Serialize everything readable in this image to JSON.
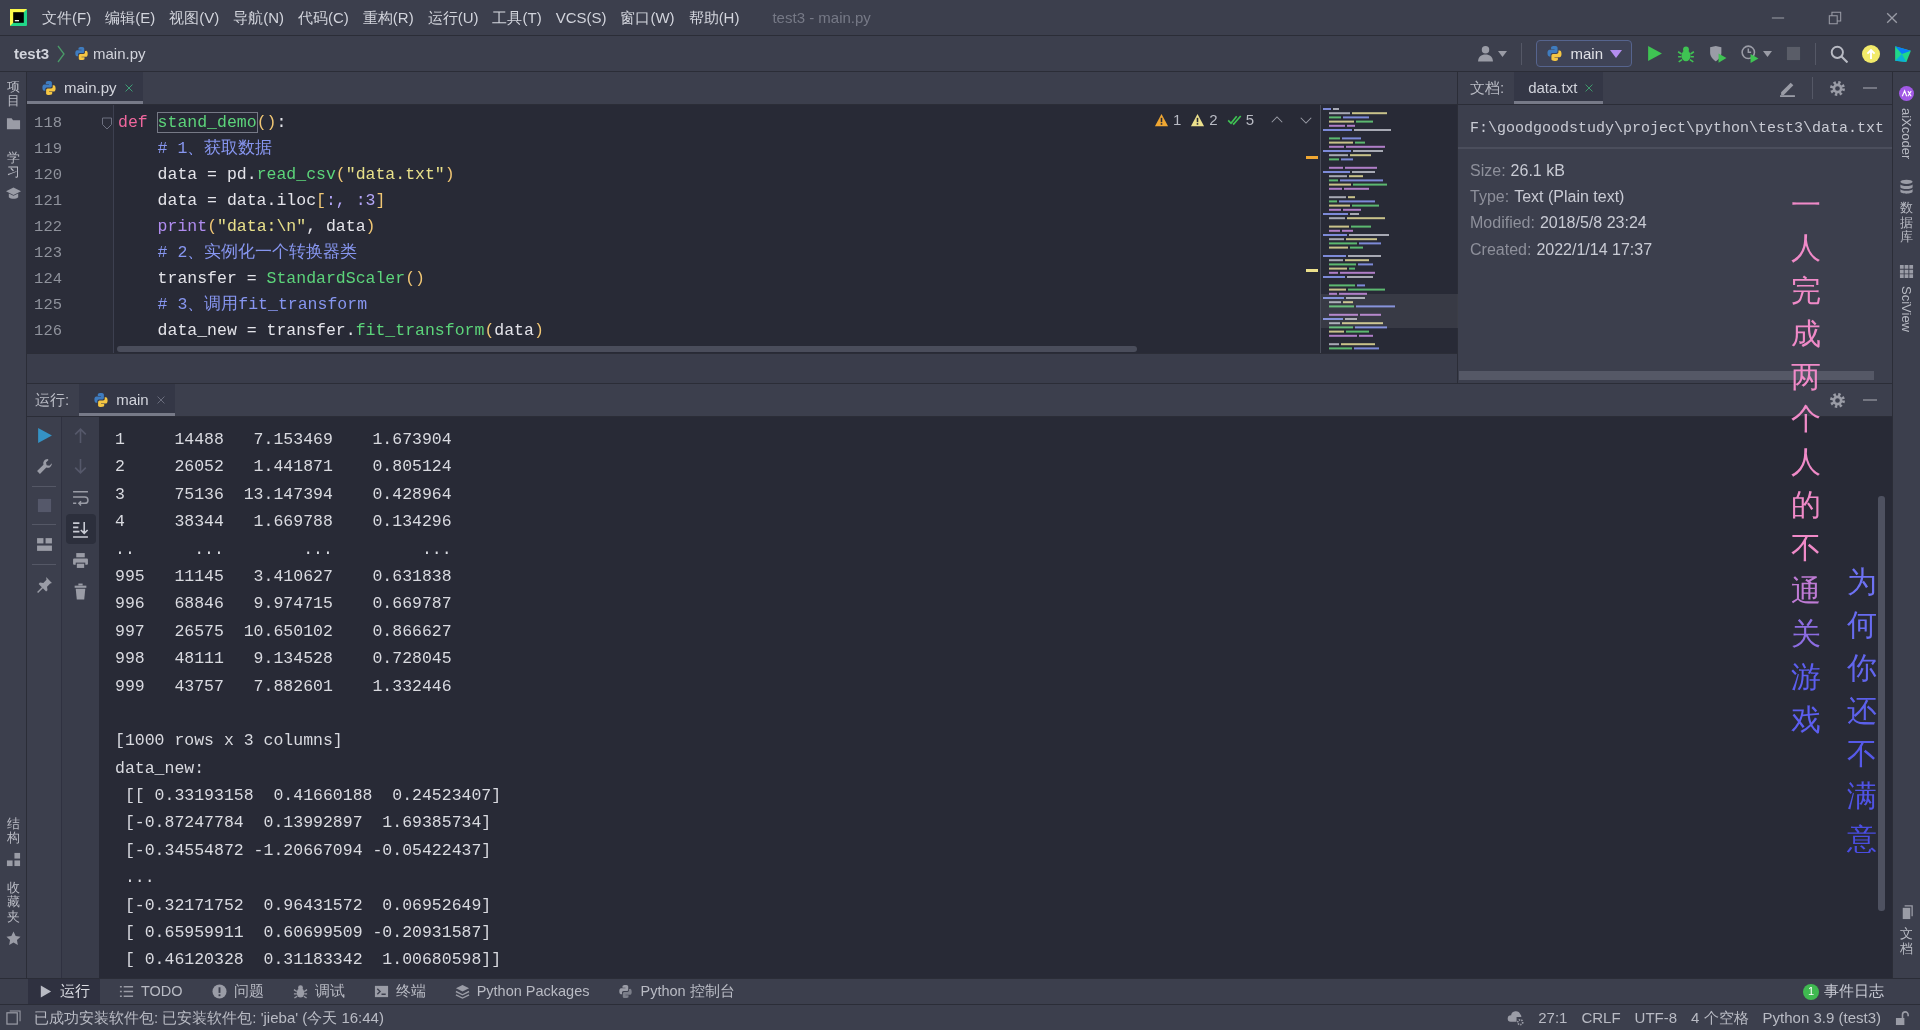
{
  "window": {
    "title": "test3 - main.py"
  },
  "menu": [
    "文件(F)",
    "编辑(E)",
    "视图(V)",
    "导航(N)",
    "代码(C)",
    "重构(R)",
    "运行(U)",
    "工具(T)",
    "VCS(S)",
    "窗口(W)",
    "帮助(H)"
  ],
  "breadcrumb": [
    {
      "label": "test3",
      "kind": "project"
    },
    {
      "label": "main.py",
      "kind": "file"
    }
  ],
  "main_toolbar": {
    "run_config": "main",
    "stop": {
      "disabled": true
    }
  },
  "left_strip": {
    "top": [
      {
        "label": "项目",
        "kind": "stacked"
      },
      {
        "label": "学习",
        "kind": "stacked"
      }
    ],
    "bottom": [
      {
        "label": "结构",
        "kind": "stacked"
      },
      {
        "label": "收藏夹",
        "kind": "stacked"
      }
    ]
  },
  "editor": {
    "tabs": [
      {
        "label": "main.py",
        "selected": true
      }
    ],
    "inspections": [
      {
        "kind": "warning",
        "count": "1"
      },
      {
        "kind": "weak_warning",
        "count": "2"
      },
      {
        "kind": "typo",
        "count": "5"
      }
    ],
    "lines": [
      {
        "number": "118",
        "foldable": true,
        "tokens": [
          {
            "kind": "keyword",
            "text": "def ",
            "highlighted": false
          },
          {
            "kind": "function",
            "text": "stand_demo",
            "highlighted": true
          },
          {
            "kind": "paren",
            "text": "()",
            "highlighted": false
          },
          {
            "kind": "plain",
            "text": ":",
            "highlighted": false
          }
        ]
      },
      {
        "number": "119",
        "foldable": false,
        "tokens": [
          {
            "kind": "comment",
            "text": "    # 1、获取数据",
            "highlighted": false
          }
        ]
      },
      {
        "number": "120",
        "foldable": false,
        "tokens": [
          {
            "kind": "plain",
            "text": "    data = pd.",
            "highlighted": false
          },
          {
            "kind": "function",
            "text": "read_csv",
            "highlighted": false
          },
          {
            "kind": "paren",
            "text": "(",
            "highlighted": false
          },
          {
            "kind": "string",
            "text": "\"data.txt\"",
            "highlighted": false
          },
          {
            "kind": "paren",
            "text": ")",
            "highlighted": false
          }
        ]
      },
      {
        "number": "121",
        "foldable": false,
        "tokens": [
          {
            "kind": "plain",
            "text": "    data = data.iloc",
            "highlighted": false
          },
          {
            "kind": "paren",
            "text": "[",
            "highlighted": false
          },
          {
            "kind": "bracket",
            "text": ":, :3",
            "highlighted": false
          },
          {
            "kind": "paren",
            "text": "]",
            "highlighted": false
          }
        ]
      },
      {
        "number": "122",
        "foldable": false,
        "tokens": [
          {
            "kind": "builtin",
            "text": "    print",
            "highlighted": false
          },
          {
            "kind": "paren",
            "text": "(",
            "highlighted": false
          },
          {
            "kind": "string",
            "text": "\"data:\\n\"",
            "highlighted": false
          },
          {
            "kind": "plain",
            "text": ", data",
            "highlighted": false
          },
          {
            "kind": "paren",
            "text": ")",
            "highlighted": false
          }
        ]
      },
      {
        "number": "123",
        "foldable": false,
        "tokens": [
          {
            "kind": "comment",
            "text": "    # 2、实例化一个转换器类",
            "highlighted": false
          }
        ]
      },
      {
        "number": "124",
        "foldable": false,
        "tokens": [
          {
            "kind": "plain",
            "text": "    transfer = ",
            "highlighted": false
          },
          {
            "kind": "function",
            "text": "StandardScaler",
            "highlighted": false
          },
          {
            "kind": "paren",
            "text": "()",
            "highlighted": false
          }
        ]
      },
      {
        "number": "125",
        "foldable": false,
        "tokens": [
          {
            "kind": "comment",
            "text": "    # 3、调用fit_transform",
            "highlighted": false
          }
        ]
      },
      {
        "number": "126",
        "foldable": false,
        "tokens": [
          {
            "kind": "plain",
            "text": "    data_new = transfer.",
            "highlighted": false
          },
          {
            "kind": "function",
            "text": "fit_transform",
            "highlighted": false
          },
          {
            "kind": "paren",
            "text": "(",
            "highlighted": false
          },
          {
            "kind": "plain",
            "text": "data",
            "highlighted": false
          },
          {
            "kind": "paren",
            "text": ")",
            "highlighted": false
          }
        ]
      }
    ]
  },
  "documentation": {
    "label": "文档:",
    "tabs": [
      {
        "label": "data.txt",
        "selected": true
      }
    ],
    "path": "F:\\goodgoodstudy\\project\\python\\test3\\data.txt",
    "fields": [
      {
        "name": "Size:",
        "value": "26.1 kB"
      },
      {
        "name": "Type:",
        "value": "Text (Plain text)"
      },
      {
        "name": "Modified:",
        "value": "2018/5/8 23:24"
      },
      {
        "name": "Created:",
        "value": "2022/1/14 17:37"
      }
    ]
  },
  "run": {
    "label": "运行:",
    "tabs": [
      {
        "label": "main",
        "selected": true
      }
    ],
    "toolbar": {
      "stop": {
        "disabled": true
      },
      "previous": {
        "disabled": true
      },
      "next": {
        "disabled": true
      },
      "scroll_to_end": {
        "on": true
      }
    },
    "output": [
      {
        "lines": [
          "1     14488   7.153469    1.673904",
          "2     26052   1.441871    0.805124",
          "3     75136  13.147394    0.428964",
          "4     38344   1.669788    0.134296",
          "..      ...        ...         ...",
          "995   11145   3.410627    0.631838",
          "996   68846   9.974715    0.669787",
          "997   26575  10.650102    0.866627",
          "998   48111   9.134528    0.728045",
          "999   43757   7.882601    1.332446"
        ]
      },
      {
        "lines": [
          "[1000 rows x 3 columns]",
          "data_new:",
          " [[ 0.33193158  0.41660188  0.24523407]",
          " [-0.87247784  0.13992897  1.69385734]",
          " [-0.34554872 -1.20667094 -0.05422437]",
          " ...",
          " [-0.32171752  0.96431572  0.06952649]",
          " [ 0.65959911  0.60699509 -0.20931587]",
          " [ 0.46120328  0.31183342  1.00680598]]"
        ]
      }
    ]
  },
  "right_strip": {
    "top": [
      {
        "label": "aiXcoder",
        "kind": "rotated"
      },
      {
        "label": "数据库",
        "kind": "stacked"
      },
      {
        "label": "SciView",
        "kind": "rotated"
      }
    ],
    "bottom": [
      {
        "label": "文档",
        "kind": "stacked"
      }
    ]
  },
  "tool_windows": [
    {
      "label": "运行",
      "selected": true
    },
    {
      "label": "TODO",
      "selected": false
    },
    {
      "label": "问题",
      "selected": false
    },
    {
      "label": "调试",
      "selected": false
    },
    {
      "label": "终端",
      "selected": false
    },
    {
      "label": "Python Packages",
      "selected": false
    },
    {
      "label": "Python 控制台",
      "selected": false
    }
  ],
  "event_log": {
    "count": "1",
    "label": "事件日志"
  },
  "status_bar": {
    "message": "已成功安装软件包: 已安装软件包: 'jieba' (今天 16:44)",
    "items": [
      "27:1",
      "CRLF",
      "UTF-8",
      "4 个空格",
      "Python 3.9 (test3)"
    ]
  },
  "desktop_lyrics": {
    "lines": [
      "一人完成两个人的不通关游戏",
      "为何你还不满意"
    ]
  }
}
